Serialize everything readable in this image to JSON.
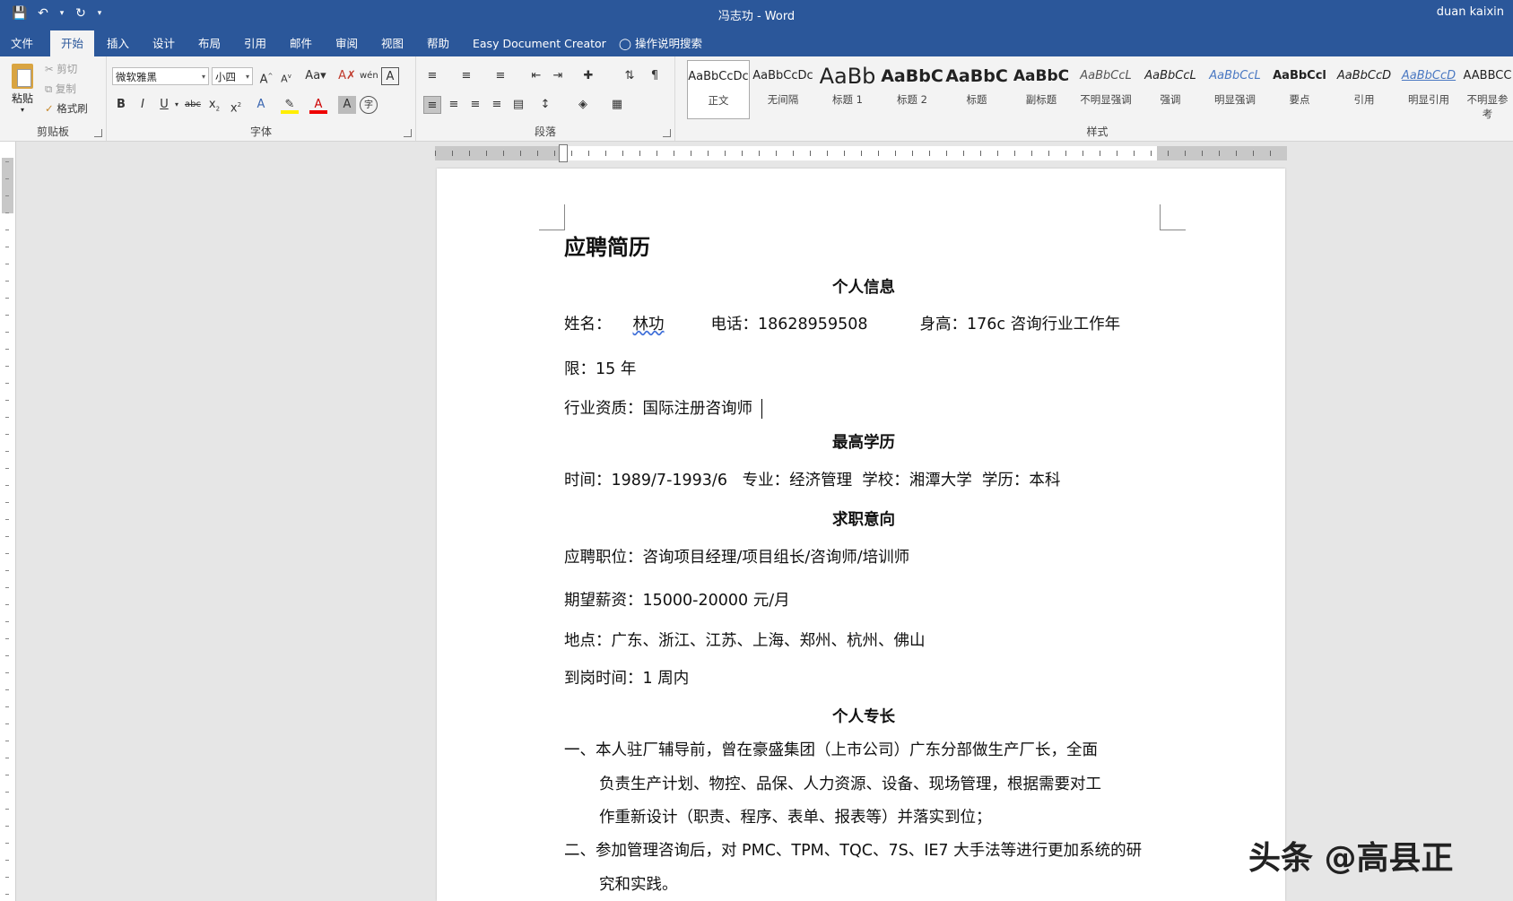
{
  "window": {
    "title": "冯志功 - Word",
    "user": "duan kaixin"
  },
  "qat": {
    "save_icon": "save-icon",
    "undo_icon": "undo-icon",
    "redo_icon": "redo-icon"
  },
  "tabs": [
    "文件",
    "开始",
    "插入",
    "设计",
    "布局",
    "引用",
    "邮件",
    "审阅",
    "视图",
    "帮助",
    "Easy Document Creator"
  ],
  "tell_me": "操作说明搜索",
  "clipboard": {
    "paste": "粘贴",
    "cut": "剪切",
    "copy": "复制",
    "format_painter": "格式刷",
    "label": "剪贴板"
  },
  "font": {
    "name": "微软雅黑",
    "size": "小四",
    "label": "字体"
  },
  "paragraph": {
    "label": "段落"
  },
  "styles": {
    "label": "样式",
    "items": [
      {
        "sample": "AaBbCcDc",
        "name": "正文"
      },
      {
        "sample": "AaBbCcDc",
        "name": "无间隔"
      },
      {
        "sample": "AaBb",
        "name": "标题 1"
      },
      {
        "sample": "AaBbC",
        "name": "标题 2"
      },
      {
        "sample": "AaBbC",
        "name": "标题"
      },
      {
        "sample": "AaBbC",
        "name": "副标题"
      },
      {
        "sample": "AaBbCcL",
        "name": "不明显强调"
      },
      {
        "sample": "AaBbCcL",
        "name": "强调"
      },
      {
        "sample": "AaBbCcL",
        "name": "明显强调"
      },
      {
        "sample": "AaBbCcl",
        "name": "要点"
      },
      {
        "sample": "AaBbCcD",
        "name": "引用"
      },
      {
        "sample": "AaBbCcD",
        "name": "明显引用"
      },
      {
        "sample": "AABBCC",
        "name": "不明显参考"
      }
    ]
  },
  "document": {
    "title": "应聘简历",
    "sec_personal": "个人信息",
    "name_label": "姓名：",
    "name_value": "林功",
    "phone": "电话：18628959508",
    "height_years": "身高：176c 咨询行业工作年",
    "years_cont": "限：15 年",
    "qualification": "行业资质：国际注册咨询师",
    "sec_edu": "最高学历",
    "edu_line": "时间：1989/7-1993/6   专业：经济管理  学校：湘潭大学  学历：本科",
    "sec_job": "求职意向",
    "position": "应聘职位：咨询项目经理/项目组长/咨询师/培训师",
    "salary": "期望薪资：15000-20000 元/月",
    "location": "地点：广东、浙江、江苏、上海、郑州、杭州、佛山",
    "start": "到岗时间：1 周内",
    "sec_skill": "个人专长",
    "skill1_a": "一、本人驻厂辅导前，曾在豪盛集团（上市公司）广东分部做生产厂长，全面",
    "skill1_b": "负责生产计划、物控、品保、人力资源、设备、现场管理，根据需要对工",
    "skill1_c": "作重新设计（职责、程序、表单、报表等）并落实到位；",
    "skill2_a": "二、参加管理咨询后，对 PMC、TPM、TQC、7S、IE7 大手法等进行更加系统的研",
    "skill2_b": "究和实践。"
  },
  "watermark": "头条 @高县正"
}
